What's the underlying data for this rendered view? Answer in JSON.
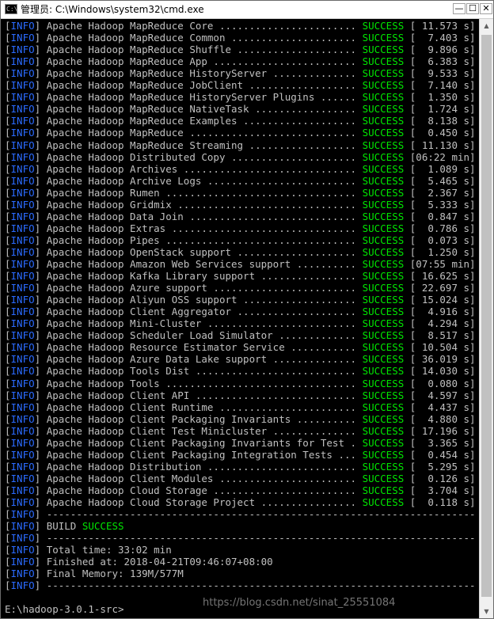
{
  "window": {
    "title": "管理员: C:\\Windows\\system32\\cmd.exe",
    "icon_text": "C:\\",
    "controls": {
      "minimize": "—",
      "maximize": "☐",
      "close": "✕"
    }
  },
  "colors": {
    "info": "#2b6bff",
    "success": "#00e600",
    "text": "#c0c0c0",
    "background": "#000000"
  },
  "console": {
    "lines": [
      "[INFO] Apache Hadoop MapReduce Core ....................... SUCCESS [ 11.573 s]",
      "[INFO] Apache Hadoop MapReduce Common ..................... SUCCESS [  7.403 s]",
      "[INFO] Apache Hadoop MapReduce Shuffle .................... SUCCESS [  9.896 s]",
      "[INFO] Apache Hadoop MapReduce App ........................ SUCCESS [  6.383 s]",
      "[INFO] Apache Hadoop MapReduce HistoryServer .............. SUCCESS [  9.533 s]",
      "[INFO] Apache Hadoop MapReduce JobClient .................. SUCCESS [  7.140 s]",
      "[INFO] Apache Hadoop MapReduce HistoryServer Plugins ...... SUCCESS [  1.350 s]",
      "[INFO] Apache Hadoop MapReduce NativeTask ................. SUCCESS [  1.724 s]",
      "[INFO] Apache Hadoop MapReduce Examples ................... SUCCESS [  8.138 s]",
      "[INFO] Apache Hadoop MapReduce ............................ SUCCESS [  0.450 s]",
      "[INFO] Apache Hadoop MapReduce Streaming .................. SUCCESS [ 11.130 s]",
      "[INFO] Apache Hadoop Distributed Copy ..................... SUCCESS [06:22 min]",
      "[INFO] Apache Hadoop Archives ............................. SUCCESS [  1.089 s]",
      "[INFO] Apache Hadoop Archive Logs ......................... SUCCESS [  5.465 s]",
      "[INFO] Apache Hadoop Rumen ................................ SUCCESS [  2.367 s]",
      "[INFO] Apache Hadoop Gridmix .............................. SUCCESS [  5.333 s]",
      "[INFO] Apache Hadoop Data Join ............................ SUCCESS [  0.847 s]",
      "[INFO] Apache Hadoop Extras ............................... SUCCESS [  0.786 s]",
      "[INFO] Apache Hadoop Pipes ................................ SUCCESS [  0.073 s]",
      "[INFO] Apache Hadoop OpenStack support .................... SUCCESS [  1.250 s]",
      "[INFO] Apache Hadoop Amazon Web Services support .......... SUCCESS [07:55 min]",
      "[INFO] Apache Hadoop Kafka Library support ................ SUCCESS [ 16.625 s]",
      "[INFO] Apache Hadoop Azure support ........................ SUCCESS [ 22.697 s]",
      "[INFO] Apache Hadoop Aliyun OSS support ................... SUCCESS [ 15.024 s]",
      "[INFO] Apache Hadoop Client Aggregator .................... SUCCESS [  4.916 s]",
      "[INFO] Apache Hadoop Mini-Cluster ......................... SUCCESS [  4.294 s]",
      "[INFO] Apache Hadoop Scheduler Load Simulator ............. SUCCESS [  8.517 s]",
      "[INFO] Apache Hadoop Resource Estimator Service ........... SUCCESS [ 10.504 s]",
      "[INFO] Apache Hadoop Azure Data Lake support .............. SUCCESS [ 36.019 s]",
      "[INFO] Apache Hadoop Tools Dist ........................... SUCCESS [ 14.030 s]",
      "[INFO] Apache Hadoop Tools ................................ SUCCESS [  0.080 s]",
      "[INFO] Apache Hadoop Client API ........................... SUCCESS [  4.597 s]",
      "[INFO] Apache Hadoop Client Runtime ....................... SUCCESS [  4.437 s]",
      "[INFO] Apache Hadoop Client Packaging Invariants .......... SUCCESS [  4.880 s]",
      "[INFO] Apache Hadoop Client Test Minicluster .............. SUCCESS [ 17.196 s]",
      "[INFO] Apache Hadoop Client Packaging Invariants for Test . SUCCESS [  3.365 s]",
      "[INFO] Apache Hadoop Client Packaging Integration Tests ... SUCCESS [  0.454 s]",
      "[INFO] Apache Hadoop Distribution ......................... SUCCESS [  5.295 s]",
      "[INFO] Apache Hadoop Client Modules ....................... SUCCESS [  0.126 s]",
      "[INFO] Apache Hadoop Cloud Storage ........................ SUCCESS [  3.704 s]",
      "[INFO] Apache Hadoop Cloud Storage Project ................ SUCCESS [  0.118 s]",
      "[INFO] ------------------------------------------------------------------------",
      "[INFO] BUILD SUCCESS",
      "[INFO] ------------------------------------------------------------------------",
      "[INFO] Total time: 33:02 min",
      "[INFO] Finished at: 2018-04-21T09:46:07+08:00",
      "[INFO] Final Memory: 139M/577M",
      "[INFO] ------------------------------------------------------------------------",
      "",
      "E:\\hadoop-3.0.1-src>"
    ]
  },
  "scrollbar": {
    "up_arrow": "▲",
    "down_arrow": "▼"
  },
  "watermark": "https://blog.csdn.net/sinat_25551084"
}
